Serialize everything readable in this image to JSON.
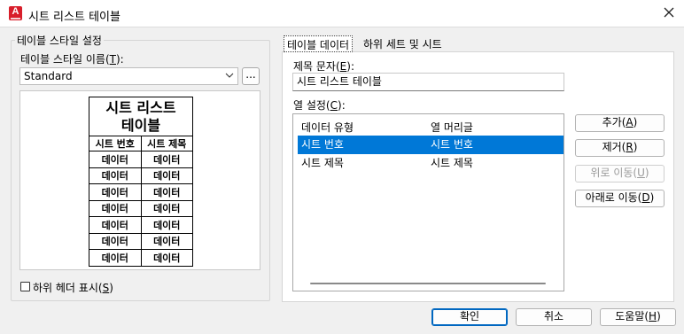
{
  "window": {
    "title": "시트 리스트 테이블",
    "close_icon": "close-icon"
  },
  "style_group": {
    "title": "테이블 스타일 설정",
    "name_label": "테이블 스타일 이름(T):",
    "name_label_pre": "테이블 스타일 이름(",
    "name_label_key": "T",
    "name_label_post": "):",
    "selected_style": "Standard",
    "browse_label": "..."
  },
  "preview": {
    "title_line1": "시트 리스트",
    "title_line2": "테이블",
    "headers": [
      "시트 번호",
      "시트 제목"
    ],
    "cell": "데이터",
    "rows": 7
  },
  "subheader_checkbox": {
    "label_pre": "하위 헤더 표시(",
    "label_key": "S",
    "label_post": ")",
    "checked": false
  },
  "tabs": [
    {
      "label": "테이블 데이터",
      "active": true
    },
    {
      "label": "하위 세트 및 시트",
      "active": false
    }
  ],
  "table_data": {
    "title_label_pre": "제목 문자(",
    "title_label_key": "E",
    "title_label_post": "):",
    "title_value": "시트 리스트 테이블",
    "columns_label_pre": "열 설정(",
    "columns_label_key": "C",
    "columns_label_post": "):",
    "list_headers": [
      "데이터 유형",
      "열 머리글"
    ],
    "list_rows": [
      {
        "type": "시트 번호",
        "heading": "시트 번호",
        "selected": true
      },
      {
        "type": "시트 제목",
        "heading": "시트 제목",
        "selected": false
      }
    ]
  },
  "side_buttons": {
    "add_pre": "추가(",
    "add_key": "A",
    "add_post": ")",
    "remove_pre": "제거(",
    "remove_key": "R",
    "remove_post": ")",
    "up_pre": "위로 이동(",
    "up_key": "U",
    "up_post": ")",
    "down_pre": "아래로 이동(",
    "down_key": "D",
    "down_post": ")"
  },
  "footer": {
    "ok": "확인",
    "cancel": "취소",
    "help_pre": "도움말(",
    "help_key": "H",
    "help_post": ")"
  },
  "colors": {
    "selection": "#0078d7",
    "app_icon": "#d81e2a"
  }
}
